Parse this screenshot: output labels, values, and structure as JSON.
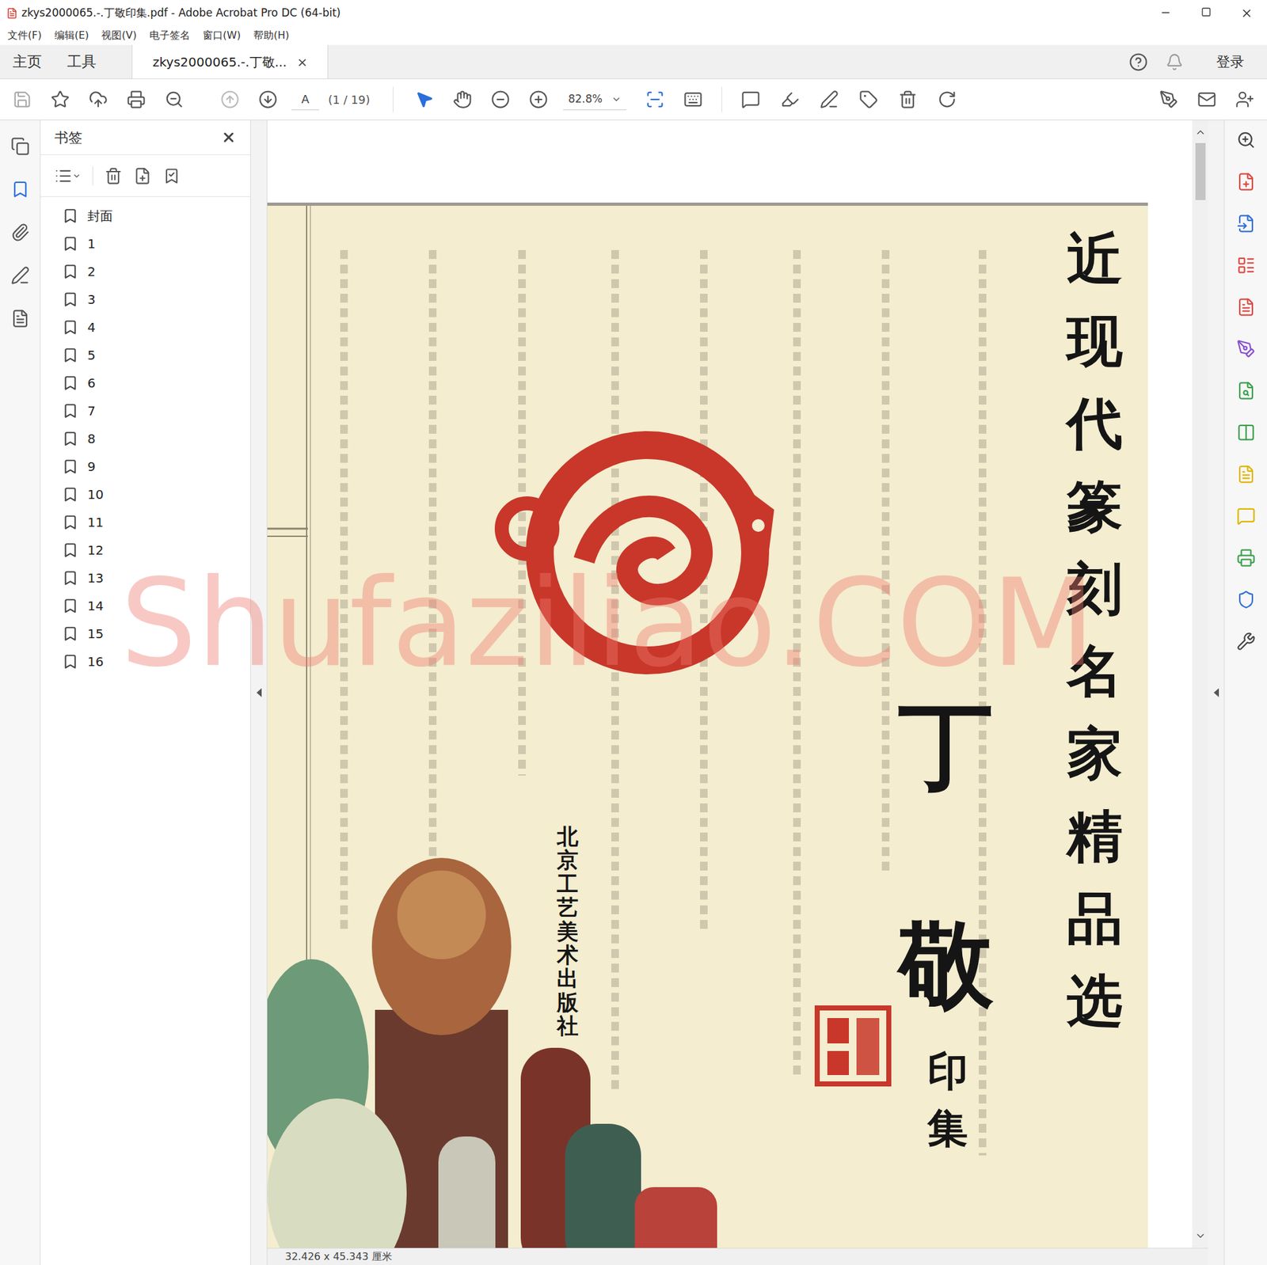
{
  "window": {
    "title": "zkys2000065.-.丁敬印集.pdf - Adobe Acrobat Pro DC (64-bit)"
  },
  "menu": [
    "文件(F)",
    "编辑(E)",
    "视图(V)",
    "电子签名",
    "窗口(W)",
    "帮助(H)"
  ],
  "tabs": [
    {
      "label": "主页",
      "selected": false,
      "closable": false
    },
    {
      "label": "工具",
      "selected": false,
      "closable": false
    },
    {
      "label": "zkys2000065.-.丁敬...",
      "selected": true,
      "closable": true,
      "close": "×"
    }
  ],
  "account": {
    "label": "登录"
  },
  "toolbar": {
    "page_field": "A",
    "page_count": "(1 / 19)",
    "zoom": "82.8%"
  },
  "left_rail": [
    {
      "kind": "pages",
      "selected": false
    },
    {
      "kind": "bookmarks",
      "selected": true
    },
    {
      "kind": "attachments",
      "selected": false
    },
    {
      "kind": "signatures",
      "selected": false
    },
    {
      "kind": "layers",
      "selected": false
    }
  ],
  "bookmarks_panel": {
    "title": "书签",
    "items": [
      "封面",
      "1",
      "2",
      "3",
      "4",
      "5",
      "6",
      "7",
      "8",
      "9",
      "10",
      "11",
      "12",
      "13",
      "14",
      "15",
      "16"
    ]
  },
  "document": {
    "cover": {
      "series": "近现代篆刻名家精品选",
      "name": "丁敬",
      "subtitle": "印集",
      "publisher": "北京工艺美术出版社"
    }
  },
  "watermark": "Shufaziliao.COM",
  "status_bar": {
    "page_size": "32.426 x 45.343 厘米"
  }
}
